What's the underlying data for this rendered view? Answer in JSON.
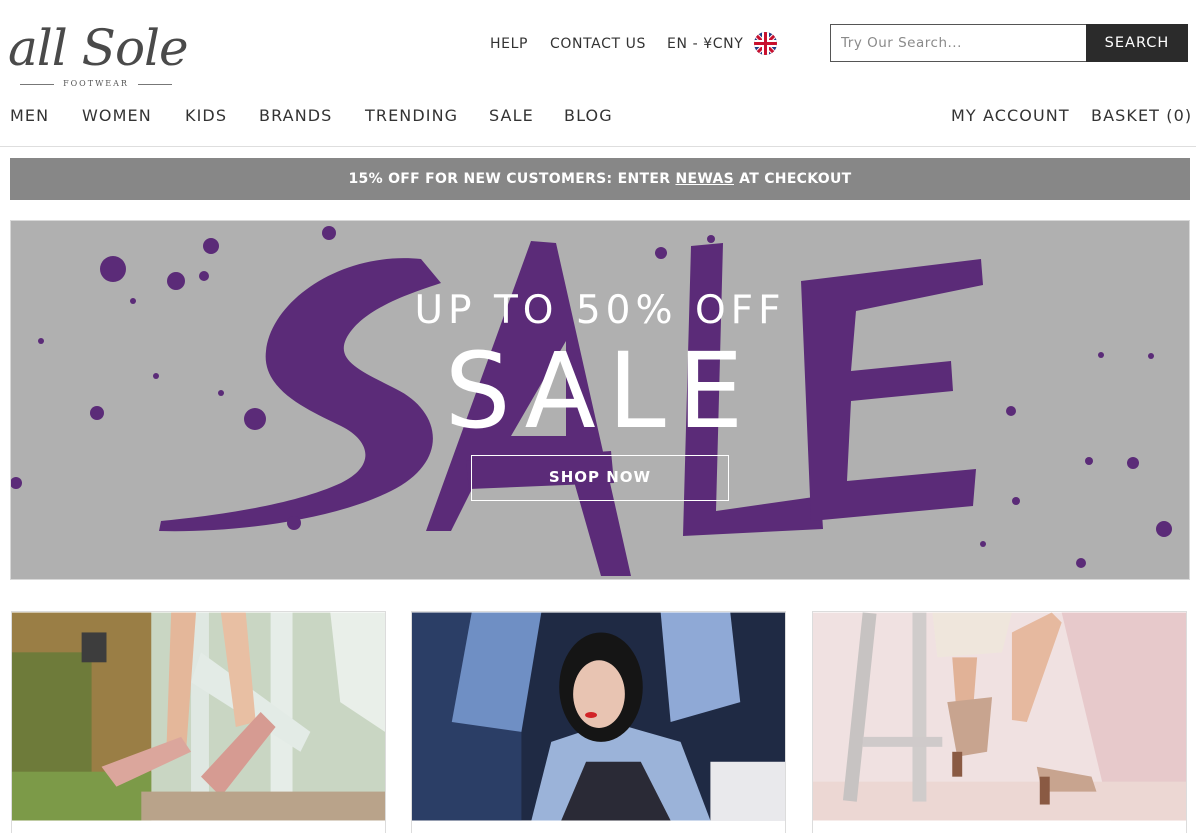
{
  "brand": {
    "logo_script": "all Sole",
    "logo_sub": "FOOTWEAR"
  },
  "utility_nav": {
    "help": "HELP",
    "contact": "CONTACT US",
    "currency": "EN - ¥CNY",
    "flag_icon": "uk-flag-icon"
  },
  "search": {
    "placeholder": "Try Our Search...",
    "value": "",
    "button_label": "SEARCH"
  },
  "main_nav": [
    {
      "label": "MEN"
    },
    {
      "label": "WOMEN"
    },
    {
      "label": "KIDS"
    },
    {
      "label": "BRANDS"
    },
    {
      "label": "TRENDING"
    },
    {
      "label": "SALE"
    },
    {
      "label": "BLOG"
    }
  ],
  "account": {
    "my_account": "MY ACCOUNT",
    "basket": "BASKET (0)"
  },
  "promo": {
    "prefix": "15% OFF FOR NEW CUSTOMERS:  ENTER ",
    "code": "NEWAS",
    "suffix": " AT CHECKOUT"
  },
  "hero": {
    "subtitle": "UP TO 50% OFF",
    "title": "SALE",
    "button": "SHOP NOW"
  },
  "colors": {
    "promo_bg": "#878787",
    "hero_bg": "#b0b0b0",
    "brush_purple": "#5b2b78",
    "button_dark": "#2b2b2b"
  },
  "tiles": [
    {
      "name": "pink-loafers-photo"
    },
    {
      "name": "fashion-model-photo"
    },
    {
      "name": "heeled-mules-photo"
    }
  ]
}
